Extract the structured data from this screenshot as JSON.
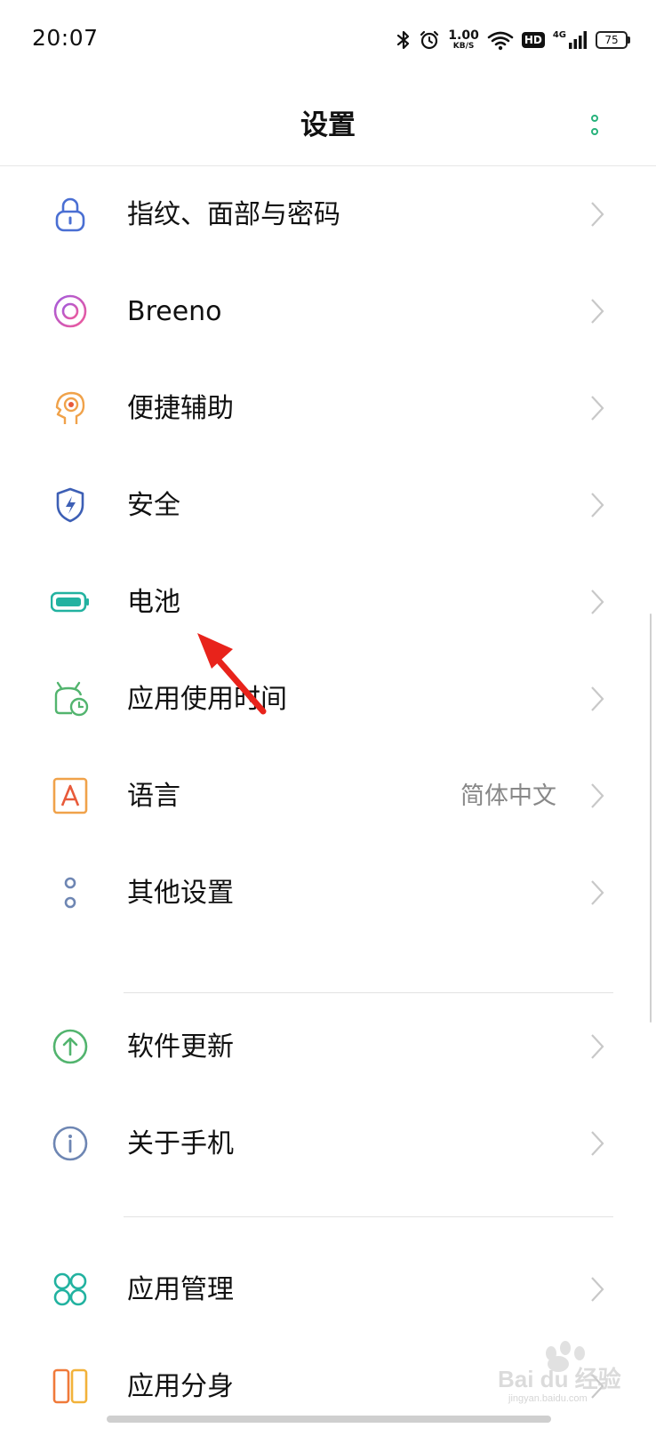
{
  "status_bar": {
    "time": "20:07",
    "speed_value": "1.00",
    "speed_unit": "KB/S",
    "hd": "HD",
    "network": "4G",
    "battery": "75",
    "icons": [
      "bluetooth-icon",
      "alarm-icon",
      "wifi-icon",
      "signal-icon"
    ]
  },
  "header": {
    "title": "设置",
    "more_icon": "more-vertical-icon",
    "accent": "#27b27b"
  },
  "items": [
    {
      "label": "指纹、面部与密码",
      "icon": "lock-icon",
      "color": "#4a6fd3"
    },
    {
      "label": "Breeno",
      "icon": "breeno-icon",
      "color": "#c05bd6"
    },
    {
      "label": "便捷辅助",
      "icon": "assist-head-icon",
      "color": "#f0a24a"
    },
    {
      "label": "安全",
      "icon": "shield-bolt-icon",
      "color": "#3d5fb5"
    },
    {
      "label": "电池",
      "icon": "battery-icon",
      "color": "#22b2a0"
    },
    {
      "label": "应用使用时间",
      "icon": "app-time-icon",
      "color": "#52b46e"
    },
    {
      "label": "语言",
      "value": "简体中文",
      "icon": "language-icon",
      "color": "#f0a24a"
    },
    {
      "label": "其他设置",
      "icon": "other-settings-icon",
      "color": "#6e86b3"
    },
    {
      "label": "软件更新",
      "icon": "update-icon",
      "color": "#52b46e"
    },
    {
      "label": "关于手机",
      "icon": "info-icon",
      "color": "#6e86b3"
    },
    {
      "label": "应用管理",
      "icon": "app-grid-icon",
      "color": "#22b2a0"
    },
    {
      "label": "应用分身",
      "icon": "app-clone-icon",
      "color": "#f07a3a"
    }
  ],
  "annotation_color": "#e8231b",
  "watermark": "Baidu经验",
  "watermark_url": "jingyan.baidu.com"
}
